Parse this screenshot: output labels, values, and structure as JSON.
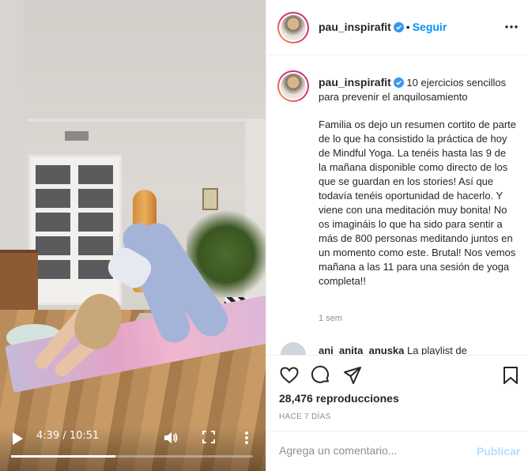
{
  "post": {
    "username": "pau_inspirafit",
    "follow_label": "Seguir",
    "separator": "•"
  },
  "caption": {
    "title": "10 ejercicios sencillos para prevenir el anquilosamiento",
    "body": "Familia os dejo un resumen cortito de parte de lo que ha consistido la práctica de hoy de Mindful Yoga. La tenéis hasta las 9 de la mañana disponible como directo de los que se guardan en los stories! Así que todavía tenéis oportunidad de hacerlo. Y viene con una meditación muy bonita! No os imagináis lo que ha sido para sentir a más de 800 personas meditando juntos en un momento como este. Brutal! Nos vemos mañana a las 11 para una sesión de yoga completa!!",
    "time": "1 sem"
  },
  "comment_preview": {
    "username": "ani_anita_anuska",
    "text": "La playlist de"
  },
  "video": {
    "time": "4:39 / 10:51",
    "progress": 0.43
  },
  "stats": {
    "views": "28,476 reproducciones",
    "date": "HACE 7 DÍAS"
  },
  "comment_box": {
    "placeholder": "Agrega un comentario...",
    "publish_label": "Publicar"
  },
  "colors": {
    "accent": "#0095f6",
    "publish_disabled": "#b2dffc",
    "verified": "#3897f0"
  },
  "icons": [
    "play-icon",
    "volume-icon",
    "fullscreen-icon",
    "more-vertical-icon",
    "more-horizontal-icon",
    "heart-icon",
    "comment-icon",
    "share-icon",
    "bookmark-icon",
    "verified-icon"
  ]
}
